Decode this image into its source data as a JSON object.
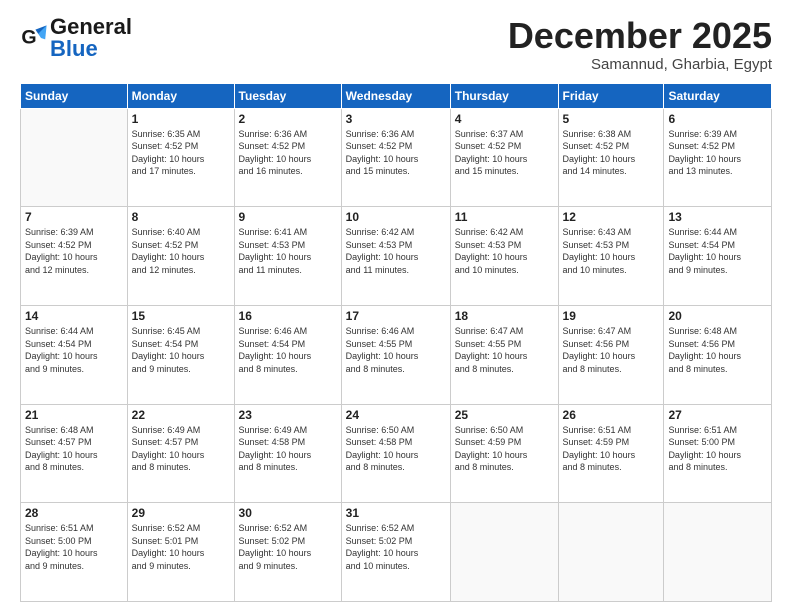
{
  "header": {
    "logo_general": "General",
    "logo_blue": "Blue",
    "month_title": "December 2025",
    "location": "Samannud, Gharbia, Egypt"
  },
  "days_of_week": [
    "Sunday",
    "Monday",
    "Tuesday",
    "Wednesday",
    "Thursday",
    "Friday",
    "Saturday"
  ],
  "weeks": [
    [
      {
        "day": "",
        "info": ""
      },
      {
        "day": "1",
        "info": "Sunrise: 6:35 AM\nSunset: 4:52 PM\nDaylight: 10 hours\nand 17 minutes."
      },
      {
        "day": "2",
        "info": "Sunrise: 6:36 AM\nSunset: 4:52 PM\nDaylight: 10 hours\nand 16 minutes."
      },
      {
        "day": "3",
        "info": "Sunrise: 6:36 AM\nSunset: 4:52 PM\nDaylight: 10 hours\nand 15 minutes."
      },
      {
        "day": "4",
        "info": "Sunrise: 6:37 AM\nSunset: 4:52 PM\nDaylight: 10 hours\nand 15 minutes."
      },
      {
        "day": "5",
        "info": "Sunrise: 6:38 AM\nSunset: 4:52 PM\nDaylight: 10 hours\nand 14 minutes."
      },
      {
        "day": "6",
        "info": "Sunrise: 6:39 AM\nSunset: 4:52 PM\nDaylight: 10 hours\nand 13 minutes."
      }
    ],
    [
      {
        "day": "7",
        "info": "Sunrise: 6:39 AM\nSunset: 4:52 PM\nDaylight: 10 hours\nand 12 minutes."
      },
      {
        "day": "8",
        "info": "Sunrise: 6:40 AM\nSunset: 4:52 PM\nDaylight: 10 hours\nand 12 minutes."
      },
      {
        "day": "9",
        "info": "Sunrise: 6:41 AM\nSunset: 4:53 PM\nDaylight: 10 hours\nand 11 minutes."
      },
      {
        "day": "10",
        "info": "Sunrise: 6:42 AM\nSunset: 4:53 PM\nDaylight: 10 hours\nand 11 minutes."
      },
      {
        "day": "11",
        "info": "Sunrise: 6:42 AM\nSunset: 4:53 PM\nDaylight: 10 hours\nand 10 minutes."
      },
      {
        "day": "12",
        "info": "Sunrise: 6:43 AM\nSunset: 4:53 PM\nDaylight: 10 hours\nand 10 minutes."
      },
      {
        "day": "13",
        "info": "Sunrise: 6:44 AM\nSunset: 4:54 PM\nDaylight: 10 hours\nand 9 minutes."
      }
    ],
    [
      {
        "day": "14",
        "info": "Sunrise: 6:44 AM\nSunset: 4:54 PM\nDaylight: 10 hours\nand 9 minutes."
      },
      {
        "day": "15",
        "info": "Sunrise: 6:45 AM\nSunset: 4:54 PM\nDaylight: 10 hours\nand 9 minutes."
      },
      {
        "day": "16",
        "info": "Sunrise: 6:46 AM\nSunset: 4:54 PM\nDaylight: 10 hours\nand 8 minutes."
      },
      {
        "day": "17",
        "info": "Sunrise: 6:46 AM\nSunset: 4:55 PM\nDaylight: 10 hours\nand 8 minutes."
      },
      {
        "day": "18",
        "info": "Sunrise: 6:47 AM\nSunset: 4:55 PM\nDaylight: 10 hours\nand 8 minutes."
      },
      {
        "day": "19",
        "info": "Sunrise: 6:47 AM\nSunset: 4:56 PM\nDaylight: 10 hours\nand 8 minutes."
      },
      {
        "day": "20",
        "info": "Sunrise: 6:48 AM\nSunset: 4:56 PM\nDaylight: 10 hours\nand 8 minutes."
      }
    ],
    [
      {
        "day": "21",
        "info": "Sunrise: 6:48 AM\nSunset: 4:57 PM\nDaylight: 10 hours\nand 8 minutes."
      },
      {
        "day": "22",
        "info": "Sunrise: 6:49 AM\nSunset: 4:57 PM\nDaylight: 10 hours\nand 8 minutes."
      },
      {
        "day": "23",
        "info": "Sunrise: 6:49 AM\nSunset: 4:58 PM\nDaylight: 10 hours\nand 8 minutes."
      },
      {
        "day": "24",
        "info": "Sunrise: 6:50 AM\nSunset: 4:58 PM\nDaylight: 10 hours\nand 8 minutes."
      },
      {
        "day": "25",
        "info": "Sunrise: 6:50 AM\nSunset: 4:59 PM\nDaylight: 10 hours\nand 8 minutes."
      },
      {
        "day": "26",
        "info": "Sunrise: 6:51 AM\nSunset: 4:59 PM\nDaylight: 10 hours\nand 8 minutes."
      },
      {
        "day": "27",
        "info": "Sunrise: 6:51 AM\nSunset: 5:00 PM\nDaylight: 10 hours\nand 8 minutes."
      }
    ],
    [
      {
        "day": "28",
        "info": "Sunrise: 6:51 AM\nSunset: 5:00 PM\nDaylight: 10 hours\nand 9 minutes."
      },
      {
        "day": "29",
        "info": "Sunrise: 6:52 AM\nSunset: 5:01 PM\nDaylight: 10 hours\nand 9 minutes."
      },
      {
        "day": "30",
        "info": "Sunrise: 6:52 AM\nSunset: 5:02 PM\nDaylight: 10 hours\nand 9 minutes."
      },
      {
        "day": "31",
        "info": "Sunrise: 6:52 AM\nSunset: 5:02 PM\nDaylight: 10 hours\nand 10 minutes."
      },
      {
        "day": "",
        "info": ""
      },
      {
        "day": "",
        "info": ""
      },
      {
        "day": "",
        "info": ""
      }
    ]
  ]
}
